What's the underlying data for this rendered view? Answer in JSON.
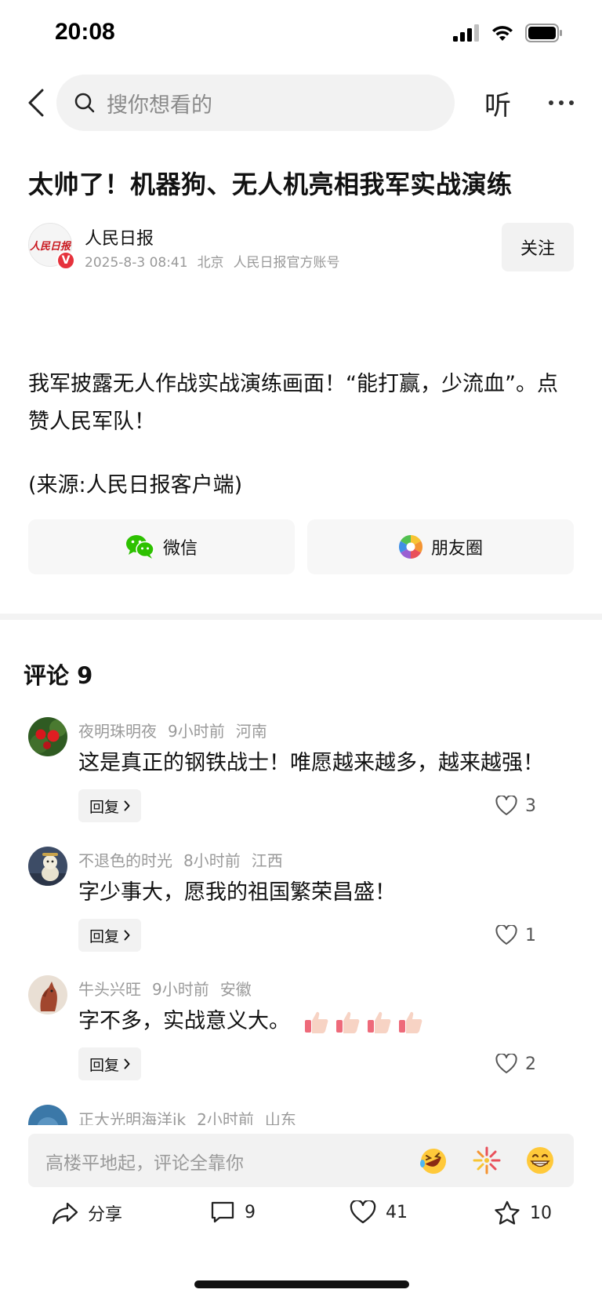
{
  "status_bar": {
    "time": "20:08"
  },
  "nav": {
    "search_placeholder": "搜你想看的",
    "listen_label": "听"
  },
  "article": {
    "title": "太帅了！机器狗、无人机亮相我军实战演练",
    "author": {
      "name": "人民日报",
      "avatar_text": "人民日报",
      "verified_mark": "V",
      "date": "2025-8-3 08:41",
      "location": "北京",
      "account_type": "人民日报官方账号",
      "follow_label": "关注"
    },
    "body": "我军披露无人作战实战演练画面！“能打赢，少流血”。点赞人民军队！",
    "source": "(来源:人民日报客户端)"
  },
  "share": {
    "wechat_label": "微信",
    "moments_label": "朋友圈"
  },
  "comments": {
    "header": "评论 9",
    "reply_label": "回复",
    "items": [
      {
        "user": "夜明珠明夜",
        "time": "9小时前",
        "location": "河南",
        "text": "这是真正的钢铁战士！唯愿越来越多，越来越强！",
        "likes": "3"
      },
      {
        "user": "不退色的时光",
        "time": "8小时前",
        "location": "江西",
        "text": "字少事大，愿我的祖国繁荣昌盛！",
        "likes": "1"
      },
      {
        "user": "牛头兴旺",
        "time": "9小时前",
        "location": "安徽",
        "text": "字不多，实战意义大。",
        "likes": "2"
      },
      {
        "user": "正大光明海洋ik",
        "time": "2小时前",
        "location": "山东"
      }
    ]
  },
  "input": {
    "placeholder": "高楼平地起，评论全靠你"
  },
  "actions": {
    "share_label": "分享",
    "comments_count": "9",
    "likes_count": "41",
    "favorites_count": "10"
  },
  "colors": {
    "wechat_green": "#2dc100",
    "verified_red": "#e6323c",
    "brand_red": "#c8161d"
  }
}
